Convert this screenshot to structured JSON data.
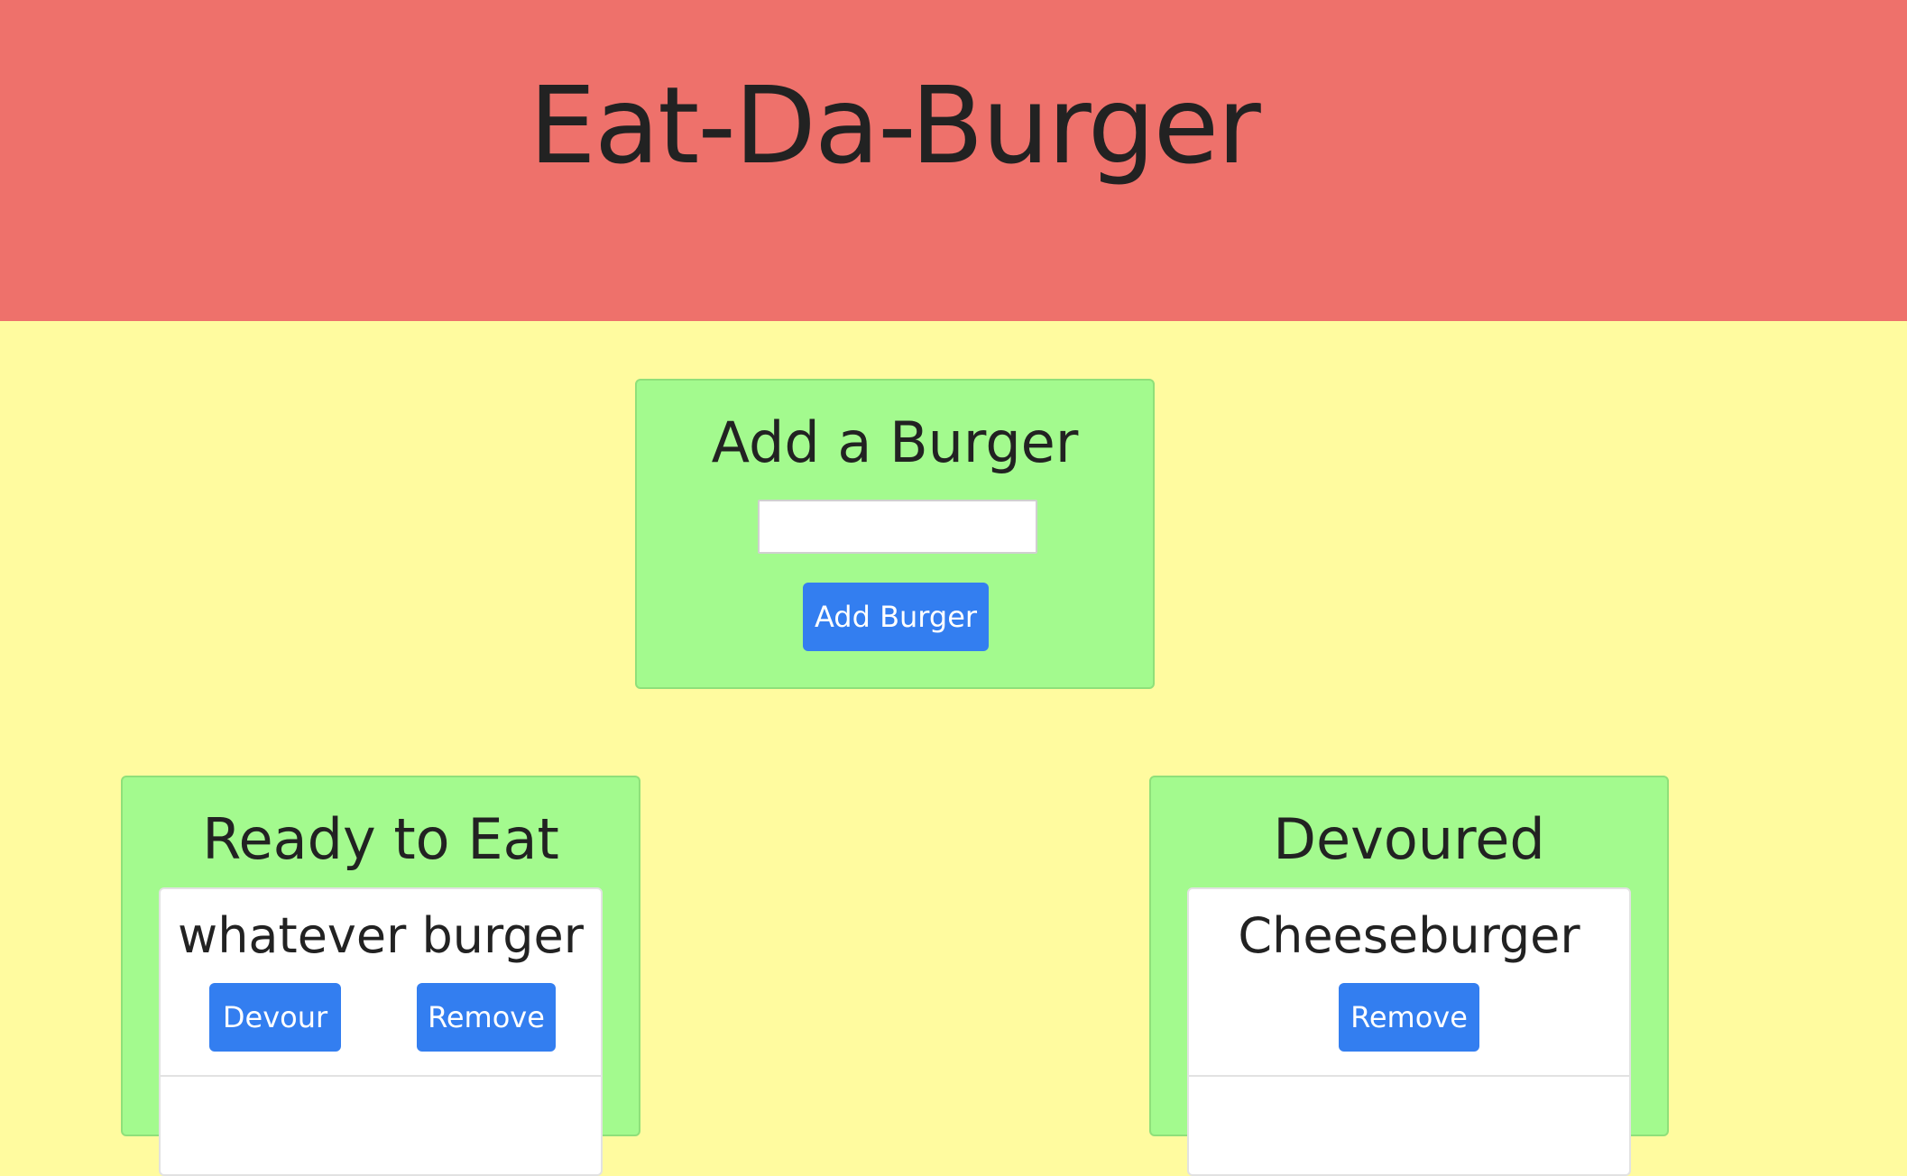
{
  "header": {
    "title": "Eat-Da-Burger"
  },
  "add_panel": {
    "title": "Add a Burger",
    "input_value": "",
    "input_placeholder": "",
    "button_label": "Add Burger"
  },
  "ready_panel": {
    "title": "Ready to Eat",
    "items": [
      {
        "name": "whatever burger",
        "devour_label": "Devour",
        "remove_label": "Remove"
      }
    ]
  },
  "devoured_panel": {
    "title": "Devoured",
    "items": [
      {
        "name": "Cheeseburger",
        "remove_label": "Remove"
      }
    ]
  },
  "colors": {
    "header_bg": "#ee716b",
    "page_bg": "#fffb9f",
    "panel_bg": "#a3fa8e",
    "button_bg": "#337ef0"
  }
}
